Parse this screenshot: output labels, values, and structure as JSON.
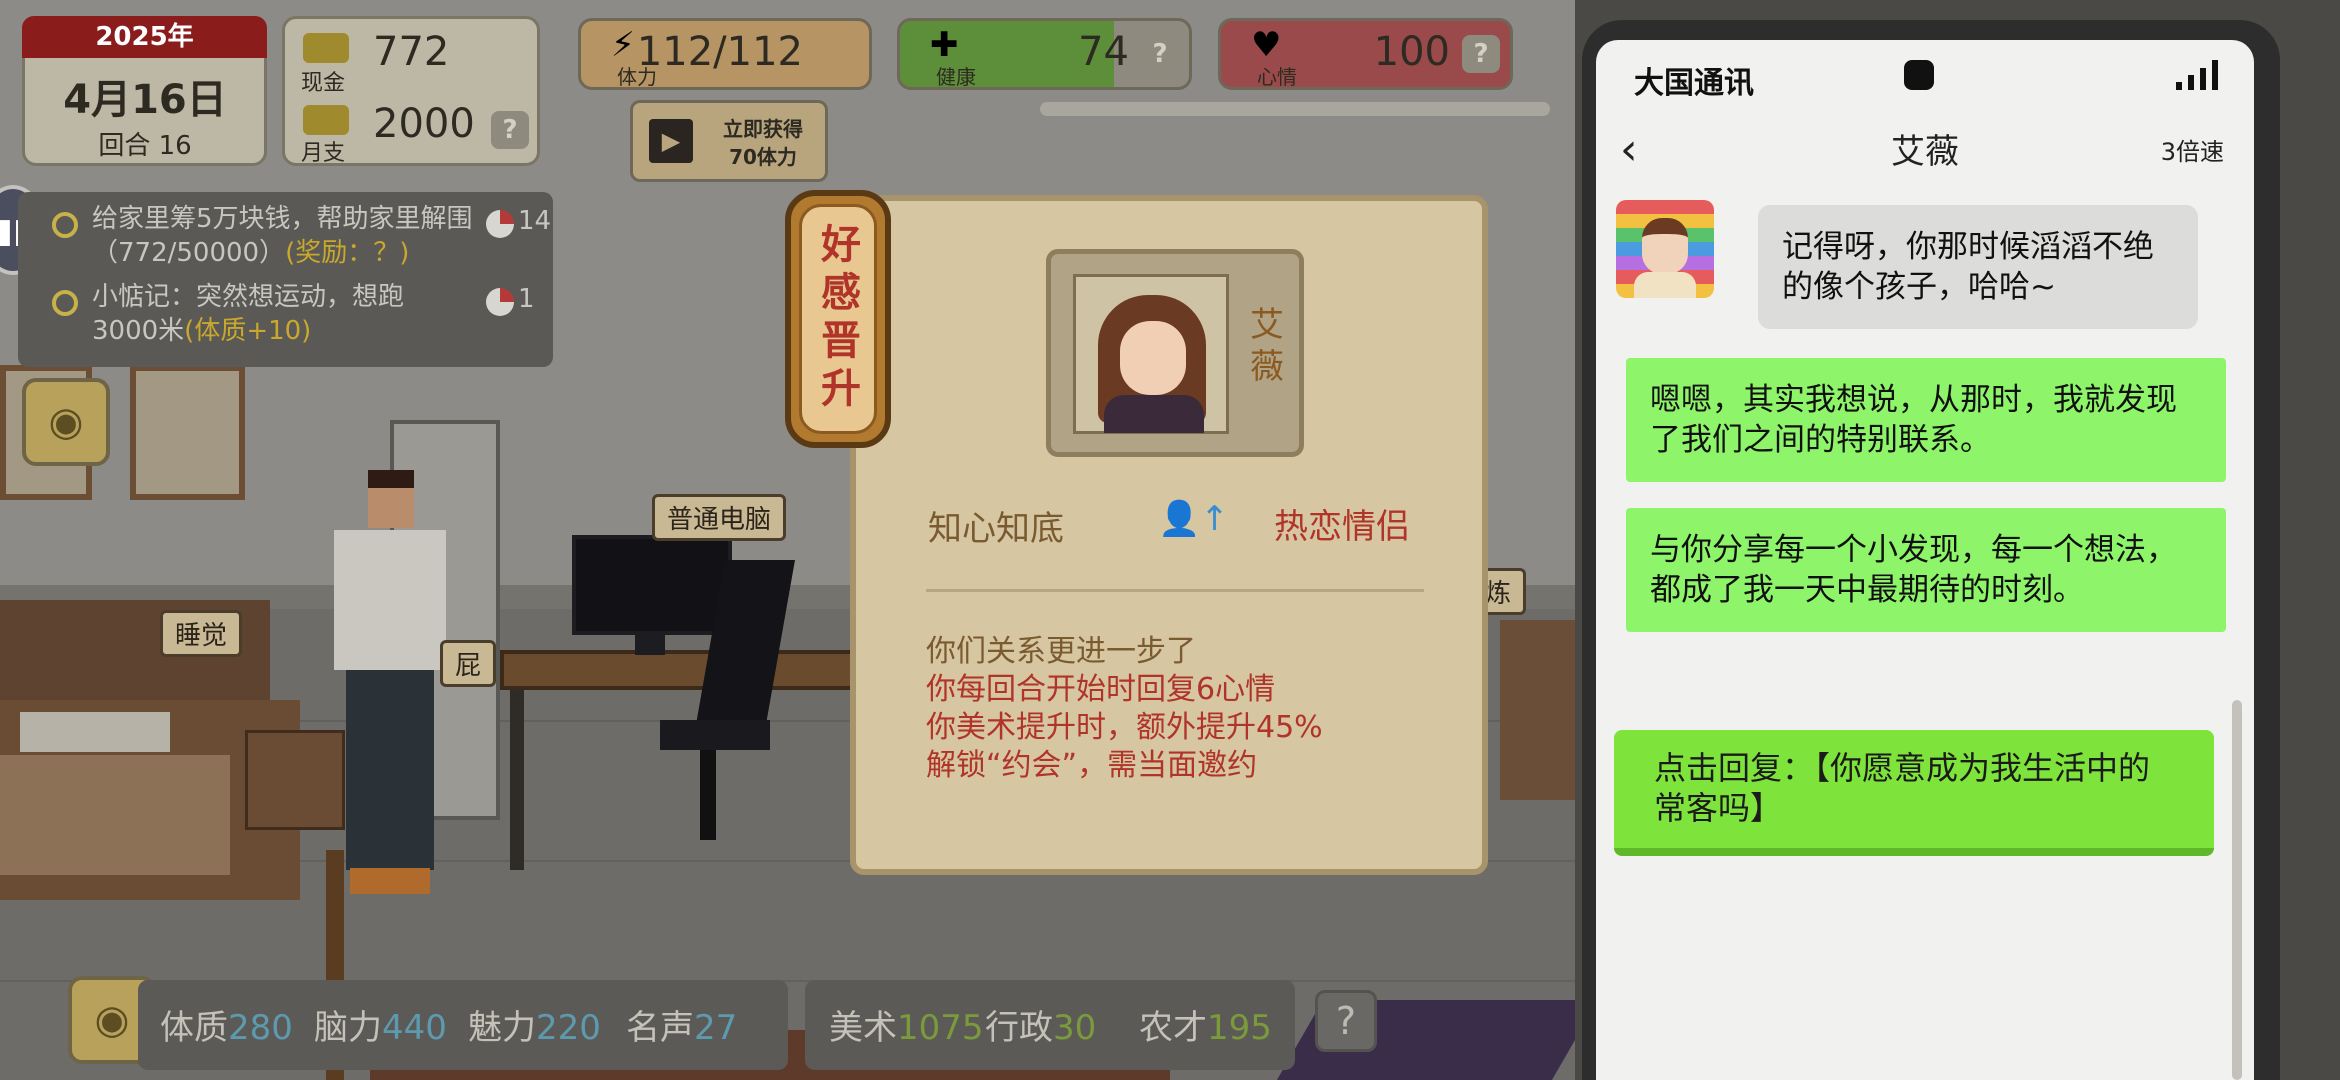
{
  "hud": {
    "year": "2025年",
    "date": "4月16日",
    "round": "回合 16",
    "cash_label": "现金",
    "cash_value": "772",
    "monthly_label": "月支",
    "monthly_value": "2000",
    "help": "?",
    "stamina_label": "体力",
    "stamina_value": "112/112",
    "health_label": "健康",
    "health_value": "74",
    "health_fraction": 0.74,
    "mood_label": "心情",
    "mood_value": "100",
    "video_reward": "立即获得\n70体力"
  },
  "tasks": [
    {
      "text": "给家里筹5万块钱，帮助家里解围（772/50000）",
      "reward": "(奖励：？)",
      "count": "14"
    },
    {
      "text": "小惦记：突然想运动，想跑3000米",
      "reward": "(体质+10)",
      "count": "1"
    }
  ],
  "scene": {
    "computer_tag": "普通电脑",
    "sleep_tag": "睡觉",
    "toilet_tag": "屁",
    "train_tag": "炼"
  },
  "attributes": {
    "physique_label": "体质",
    "physique_value": "280",
    "brain_label": "脑力",
    "brain_value": "440",
    "charm_label": "魅力",
    "charm_value": "220",
    "fame_label": "名声",
    "fame_value": "27",
    "art_label": "美术",
    "art_value": "1075",
    "admin_label": "行政",
    "admin_value": "30",
    "farm_label": "农才",
    "farm_value": "195",
    "help": "?"
  },
  "popup": {
    "banner": "好感晋升",
    "name": "艾薇",
    "from_level": "知心知底",
    "to_level": "热恋情侣",
    "effects": [
      "你们关系更进一步了",
      "你每回合开始时回复6心情",
      "你美术提升时，额外提升45%",
      "解锁“约会”，需当面邀约"
    ]
  },
  "phone": {
    "carrier": "大国通讯",
    "chat_title": "艾薇",
    "speed": "3倍速",
    "messages": [
      {
        "from": "艾薇",
        "text": "记得呀，你那时候滔滔不绝的像个孩子，哈哈~"
      },
      {
        "from": "me",
        "text": "嗯嗯，其实我想说，从那时，我就发现了我们之间的特别联系。"
      },
      {
        "from": "me",
        "text": "与你分享每一个小发现，每一个想法，都成了我一天中最期待的时刻。"
      }
    ],
    "reply_button": "点击回复：【你愿意成为我生活中的常客吗】"
  },
  "colors": {
    "reply_green": "#7ee33a",
    "outgoing_bubble": "#8ef56a",
    "popup_red": "#b0342a"
  }
}
